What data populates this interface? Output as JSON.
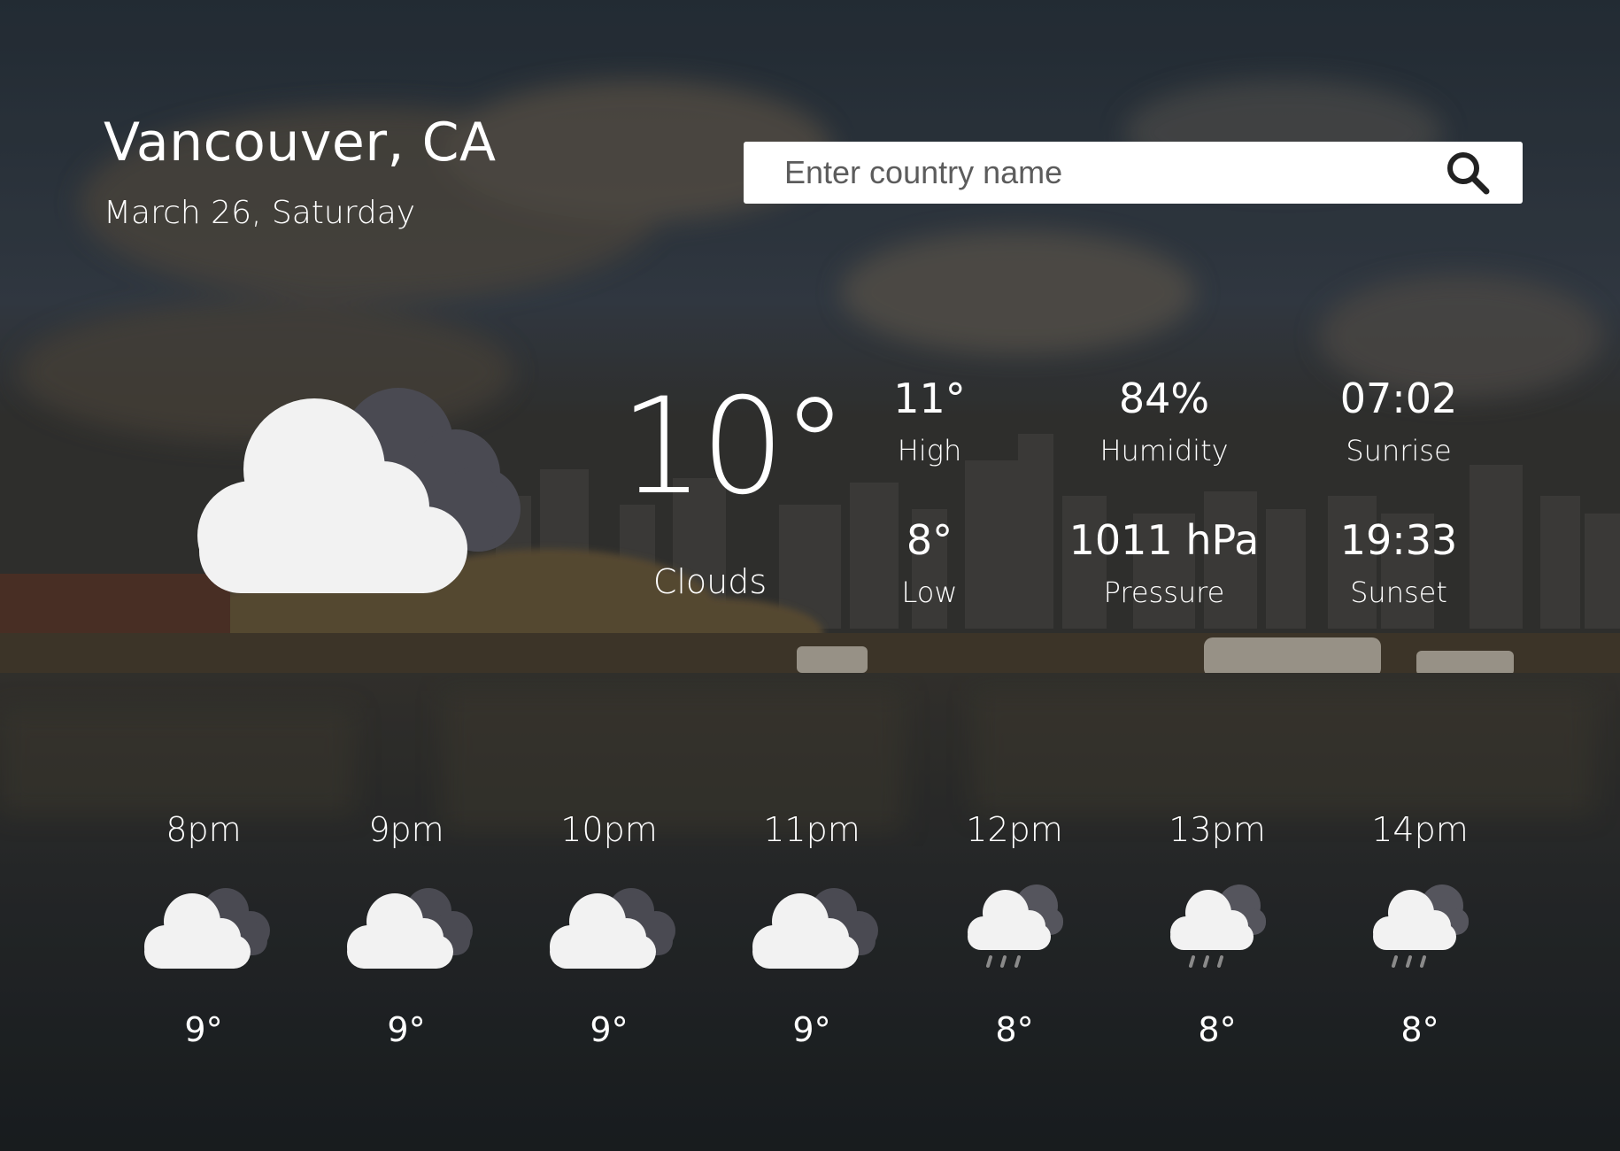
{
  "location": {
    "city": "Vancouver, CA",
    "date": "March 26, Saturday"
  },
  "search": {
    "placeholder": "Enter country name",
    "icon": "search-icon"
  },
  "current": {
    "temperature": "10°",
    "condition": "Clouds",
    "icon": "cloudy-icon",
    "stats": [
      {
        "value": "11°",
        "label": "High"
      },
      {
        "value": "84%",
        "label": "Humidity"
      },
      {
        "value": "07:02",
        "label": "Sunrise"
      },
      {
        "value": "8°",
        "label": "Low"
      },
      {
        "value": "1011 hPa",
        "label": "Pressure"
      },
      {
        "value": "19:33",
        "label": "Sunset"
      }
    ]
  },
  "hourly": [
    {
      "time": "8pm",
      "temp": "9°",
      "icon": "cloudy-icon"
    },
    {
      "time": "9pm",
      "temp": "9°",
      "icon": "cloudy-icon"
    },
    {
      "time": "10pm",
      "temp": "9°",
      "icon": "cloudy-icon"
    },
    {
      "time": "11pm",
      "temp": "9°",
      "icon": "cloudy-icon"
    },
    {
      "time": "12pm",
      "temp": "8°",
      "icon": "rain-cloud-icon"
    },
    {
      "time": "13pm",
      "temp": "8°",
      "icon": "rain-cloud-icon"
    },
    {
      "time": "14pm",
      "temp": "8°",
      "icon": "rain-cloud-icon"
    }
  ],
  "colors": {
    "text": "#ffffff",
    "search_bg": "#ffffff",
    "cloud": "#f2f2f2",
    "dark_cloud": "#4a4a52"
  }
}
